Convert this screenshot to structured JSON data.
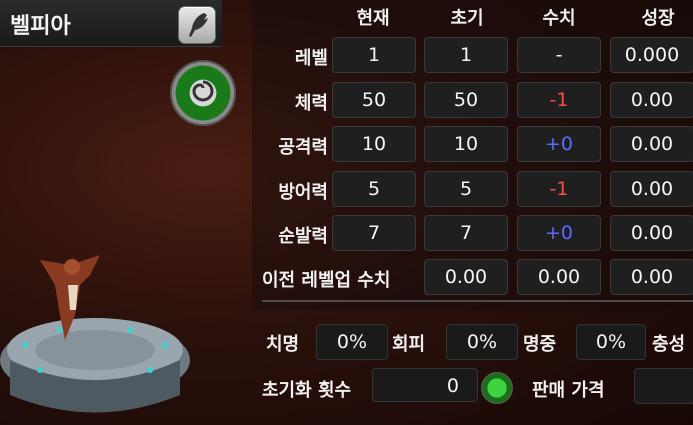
{
  "character": {
    "name": "벨피아"
  },
  "columns": [
    "현재",
    "초기",
    "수치",
    "성장"
  ],
  "rows": [
    {
      "label": "레벨",
      "current": "1",
      "initial": "1",
      "delta": "-",
      "delta_color": "white",
      "growth": "0.000"
    },
    {
      "label": "체력",
      "current": "50",
      "initial": "50",
      "delta": "-1",
      "delta_color": "red",
      "growth": "0.00"
    },
    {
      "label": "공격력",
      "current": "10",
      "initial": "10",
      "delta": "+0",
      "delta_color": "blue",
      "growth": "0.00"
    },
    {
      "label": "방어력",
      "current": "5",
      "initial": "5",
      "delta": "-1",
      "delta_color": "red",
      "growth": "0.00"
    },
    {
      "label": "순발력",
      "current": "7",
      "initial": "7",
      "delta": "+0",
      "delta_color": "blue",
      "growth": "0.00"
    }
  ],
  "prev_levelup": {
    "label": "이전 레벨업 수치",
    "values": [
      "0.00",
      "0.00",
      "0.00"
    ]
  },
  "secondary": [
    {
      "label": "치명",
      "value": "0%"
    },
    {
      "label": "회피",
      "value": "0%"
    },
    {
      "label": "명중",
      "value": "0%"
    },
    {
      "label": "충성",
      "value": ""
    }
  ],
  "reset": {
    "label": "초기화 횟수",
    "value": "0"
  },
  "sell": {
    "label": "판매 가격",
    "value": ""
  },
  "colors": {
    "red": "#ff4b4b",
    "blue": "#5a6bff",
    "cell_bg": "#1f1f1f"
  }
}
